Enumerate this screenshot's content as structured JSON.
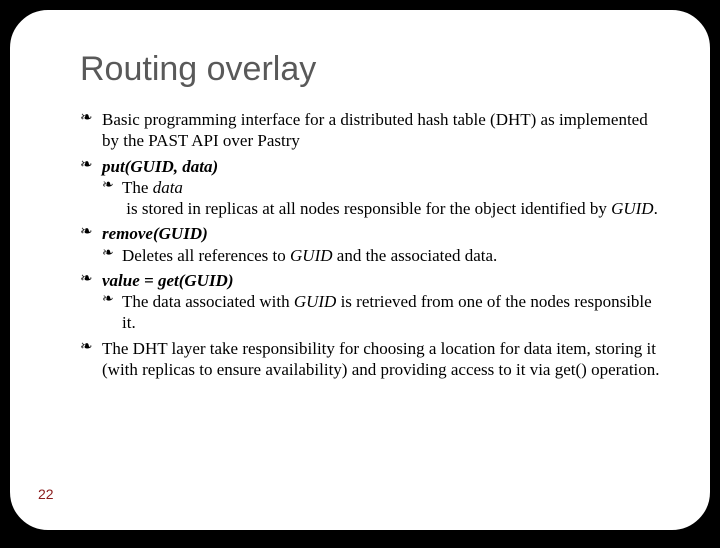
{
  "title": "Routing overlay",
  "b1a": "Basic programming interface for a distributed hash table (DHT) as implemented by the PAST API over Pastry",
  "b2": "put(GUID, data)",
  "b2s_pre": "The ",
  "b2s_data": "data",
  "b2s_mid": " is stored in replicas at all nodes responsible for the object identified by ",
  "b2s_guid": "GUID",
  "b2s_post": ".",
  "b3": "remove(GUID)",
  "b3s_pre": "Deletes all references to ",
  "b3s_guid": "GUID",
  "b3s_post": " and the associated data.",
  "b4": "value = get(GUID)",
  "b4s_pre": "The data associated with ",
  "b4s_guid": "GUID",
  "b4s_post": " is retrieved from one of the nodes responsible it.",
  "b5": "The DHT layer take responsibility for choosing a location for data item, storing it (with replicas to ensure availability) and providing access to it via get() operation.",
  "page": "22"
}
